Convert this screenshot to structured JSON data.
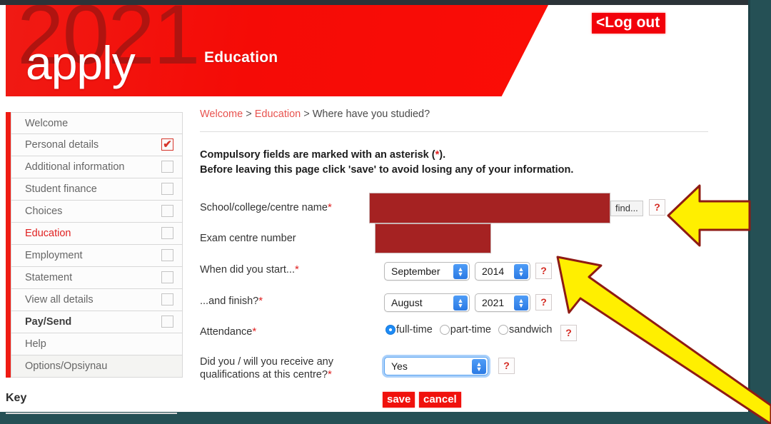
{
  "header": {
    "year": "2021",
    "brand": "apply",
    "section": "Education",
    "logout_label": "<Log out"
  },
  "sidebar": {
    "items": [
      {
        "label": "Welcome",
        "box": "none",
        "state": "normal"
      },
      {
        "label": "Personal details",
        "box": "checked",
        "state": "normal"
      },
      {
        "label": "Additional information",
        "box": "empty",
        "state": "normal"
      },
      {
        "label": "Student finance",
        "box": "empty",
        "state": "normal"
      },
      {
        "label": "Choices",
        "box": "empty",
        "state": "normal"
      },
      {
        "label": "Education",
        "box": "empty",
        "state": "active"
      },
      {
        "label": "Employment",
        "box": "empty",
        "state": "normal"
      },
      {
        "label": "Statement",
        "box": "empty",
        "state": "normal"
      },
      {
        "label": "View all details",
        "box": "empty",
        "state": "normal"
      },
      {
        "label": "Pay/Send",
        "box": "empty",
        "state": "bold"
      },
      {
        "label": "Help",
        "box": "none",
        "state": "normal"
      },
      {
        "label": "Options/Opsiynau",
        "box": "none",
        "state": "greyed"
      }
    ],
    "check_glyph": "✔",
    "key_label": "Key"
  },
  "breadcrumb": {
    "first": "Welcome",
    "second": "Education",
    "current": "Where have you studied?",
    "separator": ">"
  },
  "notice": {
    "line1_before": "Compulsory fields are marked with an asterisk (",
    "line1_ast": "*",
    "line1_after": ").",
    "line2": "Before leaving this page click 'save' to avoid losing any of your information."
  },
  "form": {
    "school_label": "School/college/centre name",
    "school_value": "",
    "exam_centre_label": "Exam centre number",
    "exam_centre_value": "",
    "find_label": "find...",
    "help_glyph": "?",
    "start_label": "When did you start...",
    "start_month": "September",
    "start_year": "2014",
    "finish_label": "...and finish?",
    "finish_month": "August",
    "finish_year": "2021",
    "attendance_label": "Attendance",
    "attendance_options": [
      {
        "label": "full-time",
        "selected": true
      },
      {
        "label": "part-time",
        "selected": false
      },
      {
        "label": "sandwich",
        "selected": false
      }
    ],
    "quals_label_line1": "Did you / will you receive any",
    "quals_label_line2": "qualifications at this centre?",
    "quals_value": "Yes",
    "save_label": "save",
    "cancel_label": "cancel",
    "asterisk": "*",
    "stepper_up": "▲",
    "stepper_down": "▼"
  },
  "annotations": {
    "arrow_fill": "#ffef00",
    "arrow_stroke": "#8e1b14",
    "arrow_left_name": "points to find and help buttons",
    "arrow_diagonal_name": "points to date help buttons"
  },
  "colors": {
    "brand_red": "#f0110c",
    "dark_red": "#b01410",
    "redaction": "#a52222",
    "frame_teal": "#255055",
    "link_red": "#e8524e"
  }
}
